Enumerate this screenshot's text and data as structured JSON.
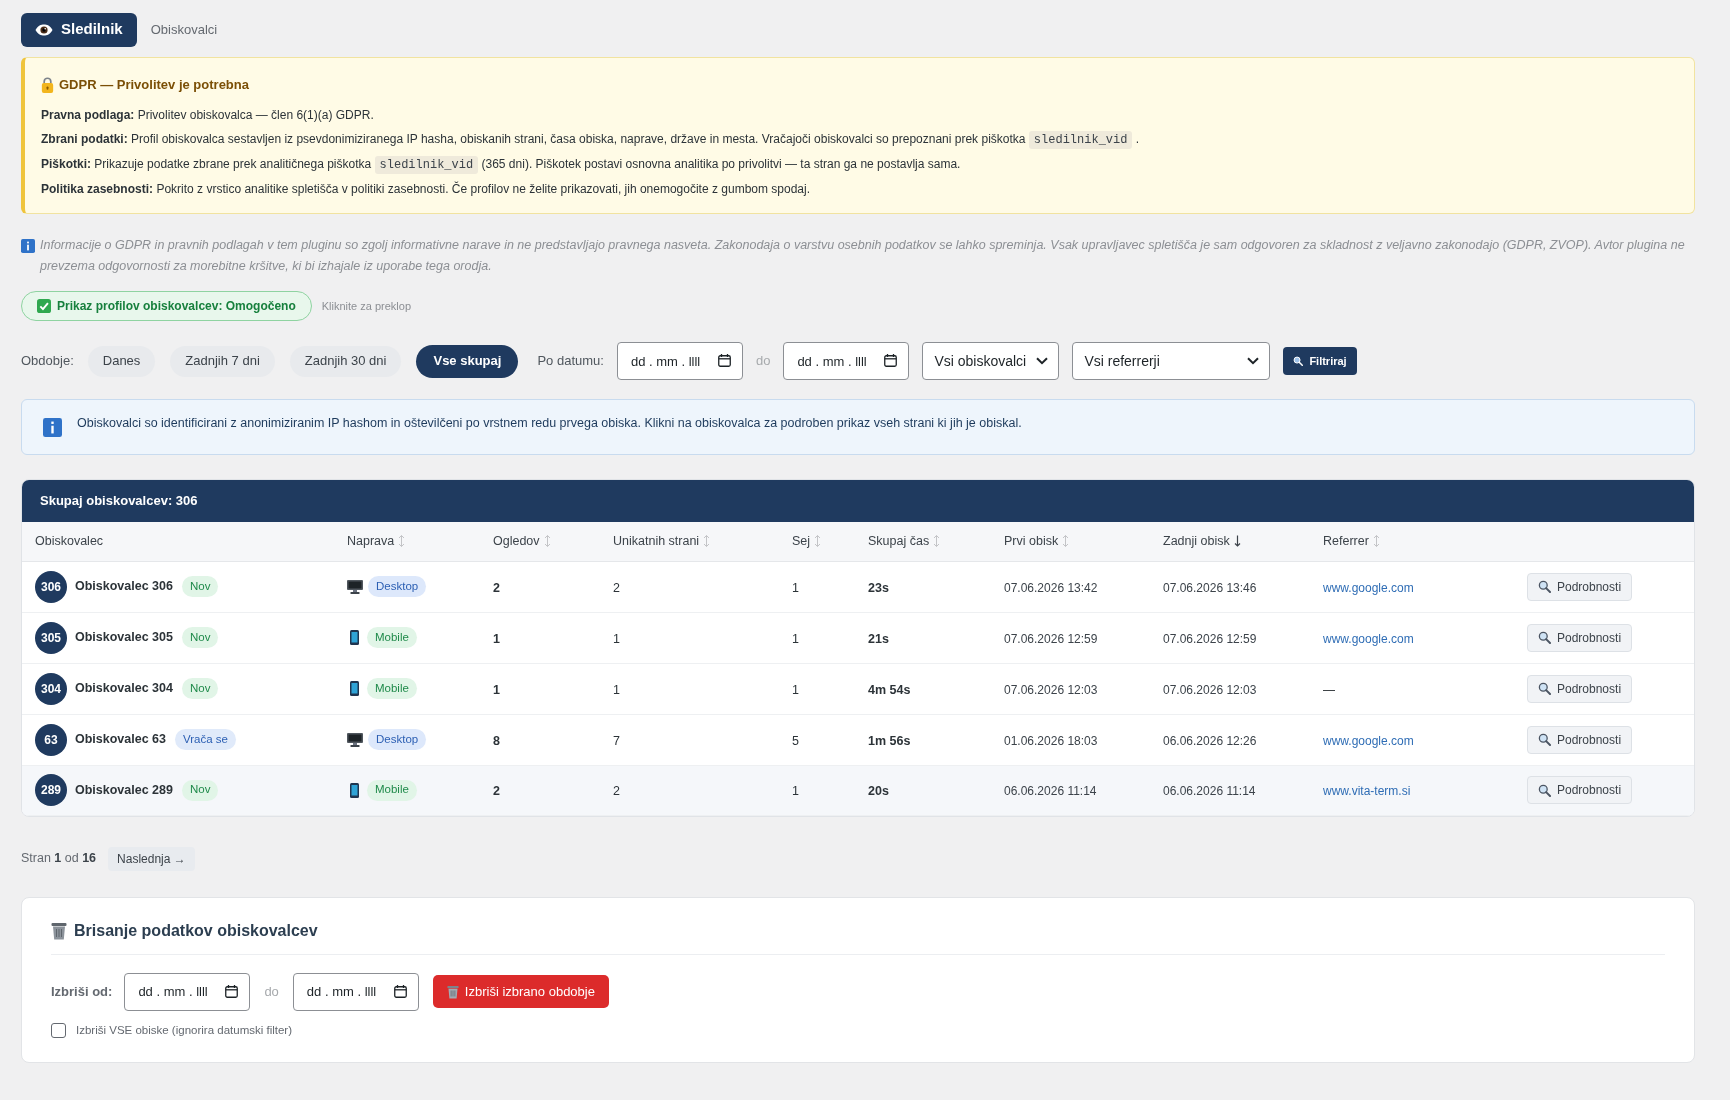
{
  "tabs": [
    {
      "label": "Sledilnik",
      "selected": true
    },
    {
      "label": "Obiskovalci",
      "selected": false
    }
  ],
  "gdpr_notice": {
    "title": "GDPR — Privolitev je potrebna",
    "lines": [
      {
        "label": "Pravna podlaga:",
        "parts": [
          {
            "kind": "text",
            "text": "Privolitev obiskovalca — člen 6(1)(a) GDPR."
          }
        ]
      },
      {
        "label": "Zbrani podatki:",
        "parts": [
          {
            "kind": "text",
            "text": "Profil obiskovalca sestavljen iz psevdonimiziranega IP hasha, obiskanih strani, časa obiska, naprave, države in mesta. Vračajoči obiskovalci so prepoznani prek piškotka"
          },
          {
            "kind": "code",
            "text": "sledilnik_vid"
          },
          {
            "kind": "text",
            "text": "."
          }
        ]
      },
      {
        "label": "Piškotki:",
        "parts": [
          {
            "kind": "text",
            "text": "Prikazuje podatke zbrane prek analitičnega piškotka"
          },
          {
            "kind": "code",
            "text": "sledilnik_vid"
          },
          {
            "kind": "text",
            "text": "(365 dni). Piškotek postavi osnovna analitika po privolitvi — ta stran ga ne postavlja sama."
          }
        ]
      },
      {
        "label": "Politika zasebnosti:",
        "parts": [
          {
            "kind": "text",
            "text": "Pokrito z vrstico analitike spletišča v politiki zasebnosti. Če profilov ne želite prikazovati, jih onemogočite z gumbom spodaj."
          }
        ]
      }
    ]
  },
  "disclaimer": "Informacije o GDPR in pravnih podlagah v tem pluginu so zgolj informativne narave in ne predstavljajo pravnega nasveta. Zakonodaja o varstvu osebnih podatkov se lahko spreminja. Vsak upravljavec spletišča je sam odgovoren za skladnost z veljavno zakonodajo (GDPR, ZVOP). Avtor plugina ne prevzema odgovornosti za morebitne kršitve, ki bi izhajale iz uporabe tega orodja.",
  "display_toggle": {
    "label": "Prikaz profilov obiskovalcev: Omogočeno",
    "on": true,
    "hint": "Kliknite za preklop"
  },
  "filters": {
    "period_label": "Obdobje:",
    "periods": [
      {
        "label": "Danes",
        "selected": false
      },
      {
        "label": "Zadnjih 7 dni",
        "selected": false
      },
      {
        "label": "Zadnjih 30 dni",
        "selected": false
      },
      {
        "label": "Vse skupaj",
        "selected": true
      }
    ],
    "date_label": "Po datumu:",
    "date_from": {
      "placeholder": "dd . mm . llll"
    },
    "date_separator": "do",
    "date_to": {
      "placeholder": "dd . mm . llll"
    },
    "visitor_select": {
      "value": "Vsi obiskovalci"
    },
    "referrer_select": {
      "value": "Vsi referrerji"
    },
    "filter_button": "Filtriraj"
  },
  "info": "Obiskovalci so identificirani z anonimiziranim IP hashom in oštevilčeni po vrstnem redu prvega obiska. Klikni na obiskovalca za podroben prikaz vseh strani ki jih je obiskal.",
  "table": {
    "title": "Skupaj obiskovalcev: 306",
    "columns": [
      {
        "label": "Obiskovalec",
        "sortable": false,
        "sorted": false
      },
      {
        "label": "Naprava",
        "sortable": true,
        "sorted": false
      },
      {
        "label": "Ogledov",
        "sortable": true,
        "sorted": false
      },
      {
        "label": "Unikatnih strani",
        "sortable": true,
        "sorted": false
      },
      {
        "label": "Sej",
        "sortable": true,
        "sorted": false
      },
      {
        "label": "Skupaj čas",
        "sortable": true,
        "sorted": false
      },
      {
        "label": "Prvi obisk",
        "sortable": true,
        "sorted": false
      },
      {
        "label": "Zadnji obisk",
        "sortable": true,
        "sorted": true
      },
      {
        "label": "Referrer",
        "sortable": true,
        "sorted": false
      }
    ],
    "rows": [
      {
        "number": "306",
        "name": "Obiskovalec 306",
        "status": {
          "kind": "new",
          "label": "Nov"
        },
        "device": {
          "kind": "desktop",
          "label": "Desktop"
        },
        "views": "2",
        "unique_pages": "2",
        "sessions": "1",
        "total_time": "23s",
        "first_visit": "07.06.2026 13:42",
        "last_visit": "07.06.2026 13:46",
        "referrer": {
          "text": "www.google.com",
          "link": true
        },
        "details_button": "Podrobnosti",
        "hovered": false
      },
      {
        "number": "305",
        "name": "Obiskovalec 305",
        "status": {
          "kind": "new",
          "label": "Nov"
        },
        "device": {
          "kind": "mobile",
          "label": "Mobile"
        },
        "views": "1",
        "unique_pages": "1",
        "sessions": "1",
        "total_time": "21s",
        "first_visit": "07.06.2026 12:59",
        "last_visit": "07.06.2026 12:59",
        "referrer": {
          "text": "www.google.com",
          "link": true
        },
        "details_button": "Podrobnosti",
        "hovered": false
      },
      {
        "number": "304",
        "name": "Obiskovalec 304",
        "status": {
          "kind": "new",
          "label": "Nov"
        },
        "device": {
          "kind": "mobile",
          "label": "Mobile"
        },
        "views": "1",
        "unique_pages": "1",
        "sessions": "1",
        "total_time": "4m 54s",
        "first_visit": "07.06.2026 12:03",
        "last_visit": "07.06.2026 12:03",
        "referrer": {
          "text": "—",
          "link": false
        },
        "details_button": "Podrobnosti",
        "hovered": false
      },
      {
        "number": "63",
        "name": "Obiskovalec 63",
        "status": {
          "kind": "returning",
          "label": "Vrača se"
        },
        "device": {
          "kind": "desktop",
          "label": "Desktop"
        },
        "views": "8",
        "unique_pages": "7",
        "sessions": "5",
        "total_time": "1m 56s",
        "first_visit": "01.06.2026 18:03",
        "last_visit": "06.06.2026 12:26",
        "referrer": {
          "text": "www.google.com",
          "link": true
        },
        "details_button": "Podrobnosti",
        "hovered": false
      },
      {
        "number": "289",
        "name": "Obiskovalec 289",
        "status": {
          "kind": "new",
          "label": "Nov"
        },
        "device": {
          "kind": "mobile",
          "label": "Mobile"
        },
        "views": "2",
        "unique_pages": "2",
        "sessions": "1",
        "total_time": "20s",
        "first_visit": "06.06.2026 11:14",
        "last_visit": "06.06.2026 11:14",
        "referrer": {
          "text": "www.vita-term.si",
          "link": true
        },
        "details_button": "Podrobnosti",
        "hovered": true
      }
    ]
  },
  "pagination": {
    "text": "Stran **1** od **16**",
    "next_button": "Naslednja →"
  },
  "delete_panel": {
    "title": "Brisanje podatkov obiskovalcev",
    "from_label": "Izbriši od:",
    "date_from": {
      "placeholder": "dd . mm . llll"
    },
    "date_separator": "do",
    "date_to": {
      "placeholder": "dd . mm . llll"
    },
    "delete_button": "Izbriši izbrano obdobje",
    "delete_all": {
      "label": "Izbriši VSE obiske (ignorira datumski filter)",
      "checked": false
    }
  }
}
